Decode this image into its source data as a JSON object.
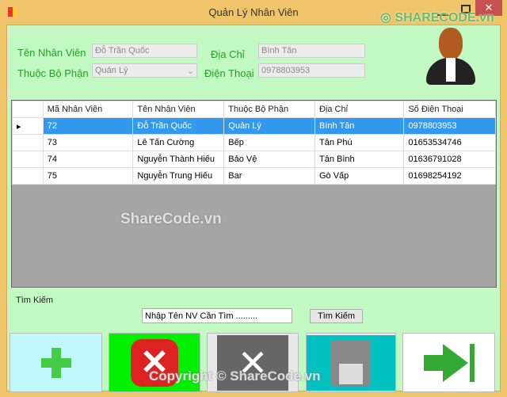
{
  "window": {
    "title": "Quản Lý Nhân Viên"
  },
  "form": {
    "ten_label": "Tên Nhân Viên",
    "ten_value": "Đỗ Trần Quốc",
    "bophan_label": "Thuộc Bộ Phận",
    "bophan_value": "Quản Lý",
    "diachi_label": "Địa Chỉ",
    "diachi_value": "Bình Tân",
    "dienthoai_label": "Điện Thoại",
    "dienthoai_value": "0978803953"
  },
  "grid": {
    "columns": [
      "Mã Nhân Viên",
      "Tên Nhân Viên",
      "Thuộc Bộ Phận",
      "Địa Chỉ",
      "Số Điện Thoại"
    ],
    "rows": [
      [
        "72",
        "Đỗ Trần Quốc",
        "Quản Lý",
        "Bình Tân",
        "0978803953"
      ],
      [
        "73",
        "Lê Tấn Cường",
        "Bếp",
        "Tân Phú",
        "01653534746"
      ],
      [
        "74",
        "Nguyễn Thành Hiếu",
        "Bảo Vệ",
        "Tân Bình",
        "01636791028"
      ],
      [
        "75",
        "Nguyễn Trung Hiếu",
        "Bar",
        "Gò Vấp",
        "01698254192"
      ]
    ],
    "selected_row": 0
  },
  "search": {
    "group_label": "Tìm Kiếm",
    "input_value": "Nhập Tên NV Cần Tìm .........",
    "button": "Tìm Kiếm"
  },
  "actions": [
    {
      "icon": "add-icon"
    },
    {
      "icon": "delete-icon"
    },
    {
      "icon": "edit-tools-icon"
    },
    {
      "icon": "save-icon"
    },
    {
      "icon": "exit-icon"
    }
  ],
  "watermarks": {
    "logo": "SHARECODE.vn",
    "center": "ShareCode.vn",
    "bottom": "Copyright © ShareCode.vn"
  }
}
